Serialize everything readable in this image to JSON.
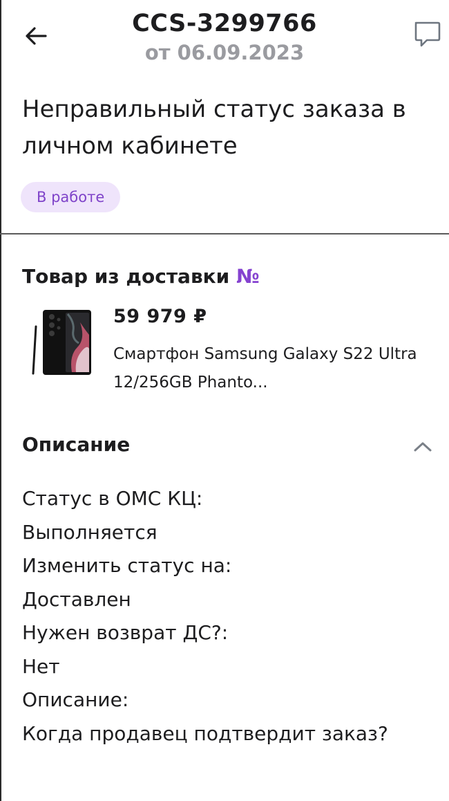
{
  "header": {
    "ticket_id": "CCS-3299766",
    "date_text": "от 06.09.2023",
    "back_icon": "arrow-left-icon",
    "chat_icon": "chat-bubble-icon"
  },
  "ticket": {
    "subject": "Неправильный статус заказа в личном кабинете",
    "status": "В работе"
  },
  "product_section": {
    "title": "Товар из доставки",
    "number_sign": "№",
    "product": {
      "price": "59 979 ₽",
      "name": "Смартфон Samsung Galaxy S22 Ultra 12/256GB Phanto..."
    }
  },
  "description": {
    "title": "Описание",
    "chevron_icon": "chevron-up-icon",
    "lines": [
      "Статус в ОМС КЦ:",
      "Выполняется",
      "Изменить статус на:",
      "Доставлен",
      "Нужен возврат ДС?:",
      "Нет",
      "Описание:",
      "Когда продавец подтвердит заказ?"
    ]
  },
  "colors": {
    "status_badge_bg": "#efe4fb",
    "status_badge_text": "#7f43c9",
    "accent": "#8542d0",
    "muted_text": "#9a9ba0"
  }
}
